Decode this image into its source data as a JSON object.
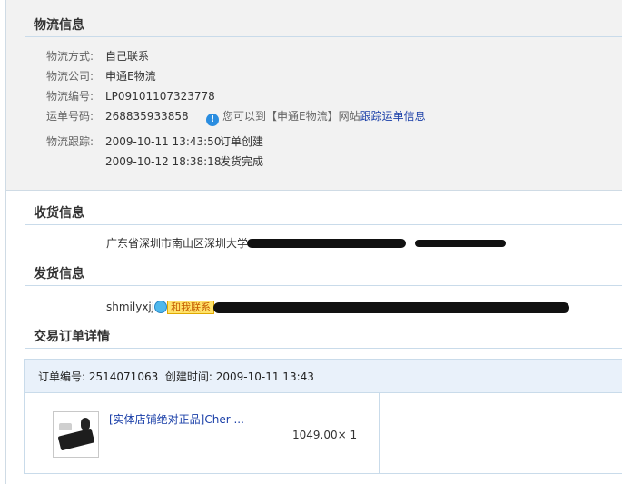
{
  "logistics": {
    "title": "物流信息",
    "method_label": "物流方式:",
    "method_value": "自己联系",
    "company_label": "物流公司:",
    "company_value": "申通E物流",
    "number_label": "物流编号:",
    "number_value": "LP09101107323778",
    "waybill_label": "运单号码:",
    "waybill_value": "268835933858",
    "notice_prefix": "您可以到【申通E物流】网站",
    "notice_link": "跟踪运单信息",
    "tracking_label": "物流跟踪:",
    "tracking": [
      {
        "time": "2009-10-11 13:43:50",
        "event": "订单创建"
      },
      {
        "time": "2009-10-12 18:38:18",
        "event": "发货完成"
      }
    ]
  },
  "receiver": {
    "title": "收货信息",
    "address": "广东省深圳市南山区深圳大学"
  },
  "sender": {
    "title": "发货信息",
    "name": "shmilyxjj",
    "contact_label": "和我联系"
  },
  "order": {
    "title": "交易订单详情",
    "number_label": "订单编号:",
    "number_value": "2514071063",
    "created_label": "创建时间:",
    "created_value": "2009-10-11 13:43",
    "product_title": "[实体店铺绝对正品]Cher ...",
    "price": "1049.00",
    "quantity": "× 1"
  },
  "colors": {
    "accent_link": "#1a3fa8",
    "section_rule": "#c9dbea",
    "panel_bg": "#f2f2f2",
    "order_head_bg": "#e9f1fa"
  }
}
